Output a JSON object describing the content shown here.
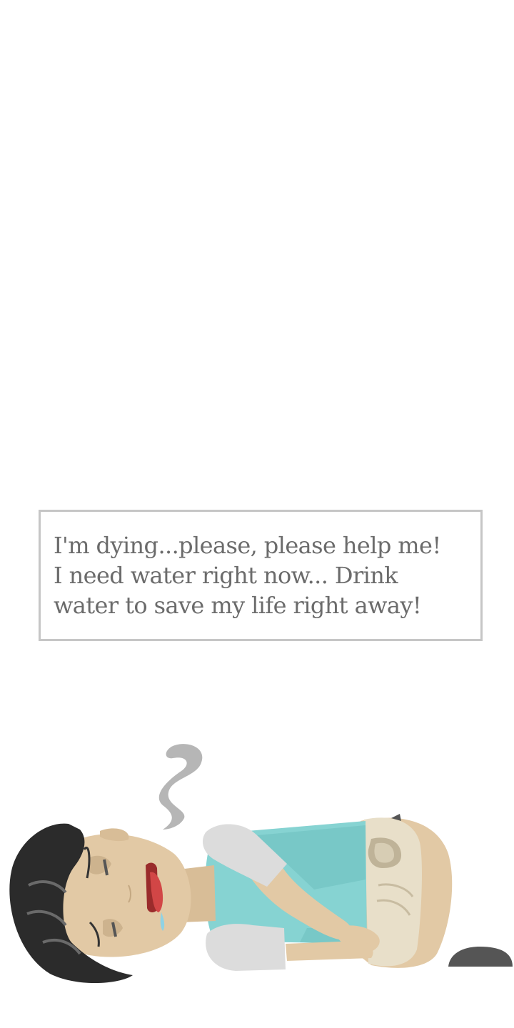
{
  "dialog": {
    "lines": [
      "I'm dying...please, please help me!",
      "I need water right now... Drink",
      "water to save my life right away!"
    ]
  },
  "scene": {
    "character": "thirsty-boy-lying-down",
    "icons": [
      "breath-puff-icon",
      "tongue-out-icon",
      "sweat-drop-icon",
      "dark-rock-icon"
    ],
    "colors": {
      "skin": "#e2c9a5",
      "hair": "#2b2b2b",
      "shirt": "#86d3d2",
      "sleeve": "#dcdcdc",
      "pants": "#e5dcc6",
      "rock": "#555555",
      "dialog_border": "#c6c6c6",
      "dialog_text": "#6b6b6b"
    }
  }
}
